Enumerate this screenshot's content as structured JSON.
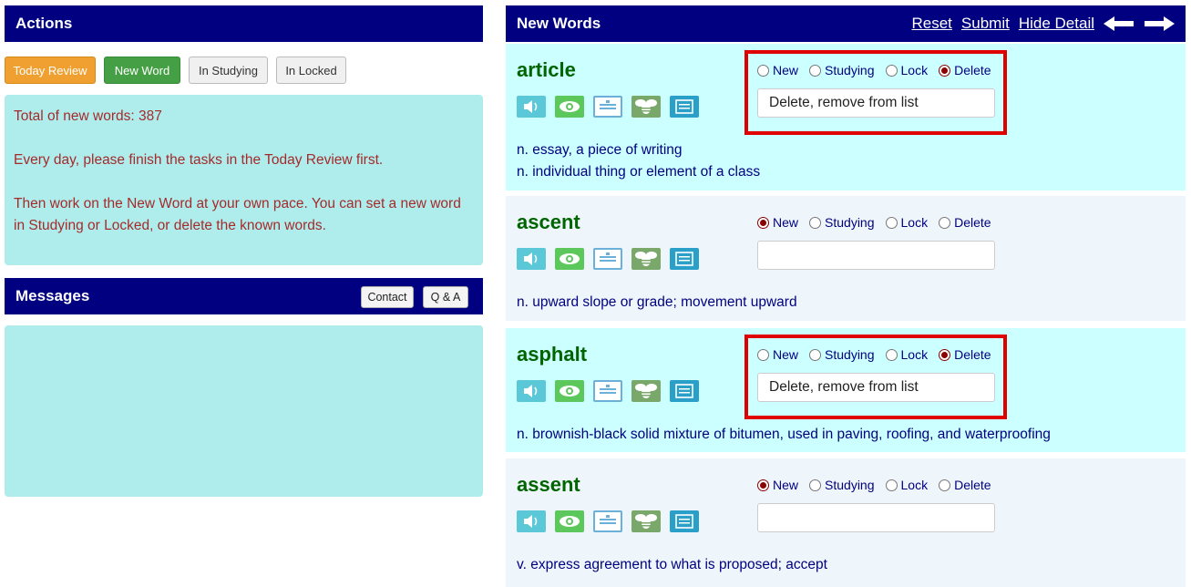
{
  "actions": {
    "title": "Actions",
    "buttons": [
      "Today Review",
      "New Word",
      "In Studying",
      "In Locked"
    ],
    "info": [
      "Total of new words: 387",
      "Every day, please finish the tasks in the Today Review first.",
      "Then work on the New Word at your own pace. You can set a new word in Studying or Locked, or delete the known words."
    ]
  },
  "messages": {
    "title": "Messages",
    "contact_label": "Contact",
    "qa_label": "Q & A"
  },
  "new_words": {
    "title": "New Words",
    "reset_label": "Reset",
    "submit_label": "Submit",
    "hide_detail_label": "Hide Detail",
    "status_options": [
      "New",
      "Studying",
      "Lock",
      "Delete"
    ],
    "words": [
      {
        "word": "article",
        "selected": "Delete",
        "note": "Delete, remove from list",
        "definitions": [
          "n. essay, a piece of writing",
          "n. individual thing or element of a class"
        ]
      },
      {
        "word": "ascent",
        "selected": "New",
        "note": "",
        "definitions": [
          "n. upward slope or grade; movement upward"
        ]
      },
      {
        "word": "asphalt",
        "selected": "Delete",
        "note": "Delete, remove from list",
        "definitions": [
          "n. brownish-black solid mixture of bitumen, used in paving, roofing, and waterproofing"
        ]
      },
      {
        "word": "assent",
        "selected": "New",
        "note": "",
        "definitions": [
          "v. express agreement to what is proposed; accept"
        ]
      }
    ]
  },
  "colors": {
    "header_bg": "#000080",
    "highlight_card_bg": "#ccffff",
    "normal_card_bg": "#eef6fb",
    "word_color": "#006400",
    "highlight_border": "#e00000"
  },
  "icons": [
    "speaker-icon",
    "eye-icon",
    "card-icon",
    "bee-icon",
    "book-icon"
  ]
}
